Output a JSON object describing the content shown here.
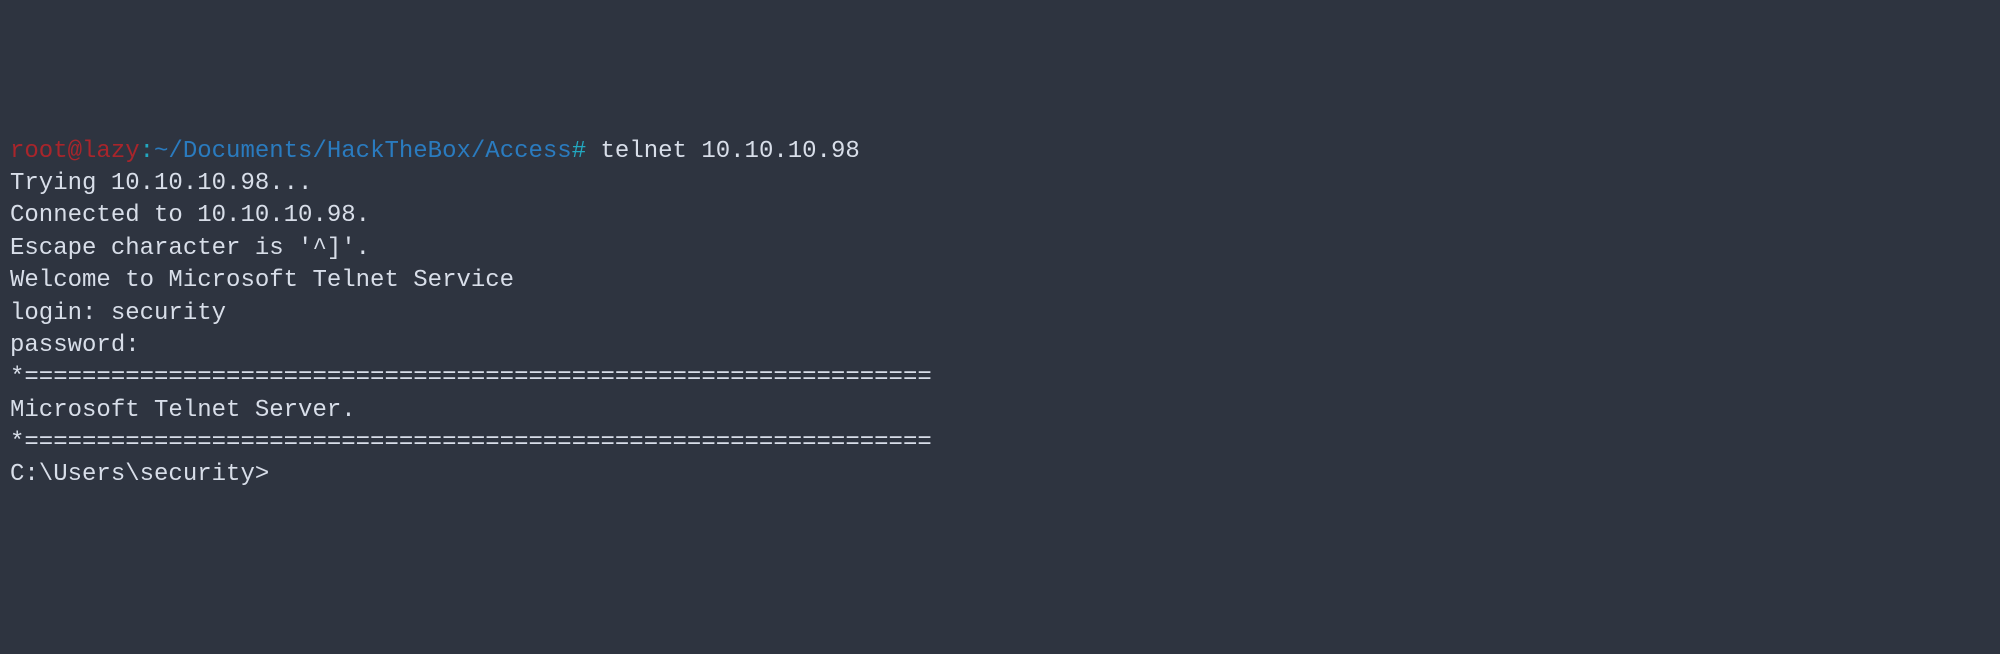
{
  "prompt": {
    "user": "root",
    "at": "@",
    "host": "lazy",
    "colon": ":",
    "path": "~/Documents/HackTheBox/Access",
    "hash": "#",
    "command": " telnet 10.10.10.98"
  },
  "output": {
    "trying": "Trying 10.10.10.98...",
    "connected": "Connected to 10.10.10.98.",
    "escape": "Escape character is '^]'.",
    "welcome": "Welcome to Microsoft Telnet Service",
    "blank1": "",
    "login": "login: security",
    "password": "password:",
    "blank2": "",
    "sep1": "*===============================================================",
    "server": "Microsoft Telnet Server.",
    "sep2": "*===============================================================",
    "winprompt": "C:\\Users\\security>"
  }
}
